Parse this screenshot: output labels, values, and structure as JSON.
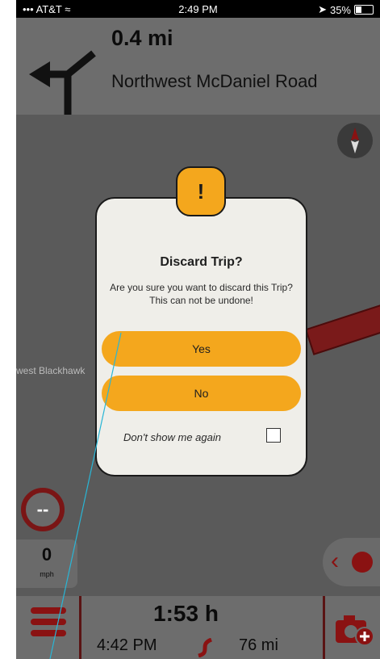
{
  "status_bar": {
    "carrier": "AT&T",
    "time": "2:49 PM",
    "battery": "35%",
    "battery_level": 0.35
  },
  "navigation": {
    "distance": "0.4 mi",
    "street": "Northwest McDaniel Road",
    "maneuver_icon": "turn-left-arrow-icon"
  },
  "map": {
    "street_label": "west Blackhawk"
  },
  "speed": {
    "limit": "--",
    "value": "0",
    "unit": "mph"
  },
  "trip": {
    "duration": "1:53 h",
    "eta": "4:42 PM",
    "distance": "76 mi"
  },
  "dialog": {
    "icon": "!",
    "title": "Discard Trip?",
    "message": "Are you sure you want to discard this Trip? This can not be undone!",
    "yes_label": "Yes",
    "no_label": "No",
    "dont_show_label": "Don't show me again",
    "dont_show_checked": false
  },
  "colors": {
    "accent": "#f4a71d",
    "brand_red": "#8a1212",
    "dialog_bg": "#efeee9"
  }
}
